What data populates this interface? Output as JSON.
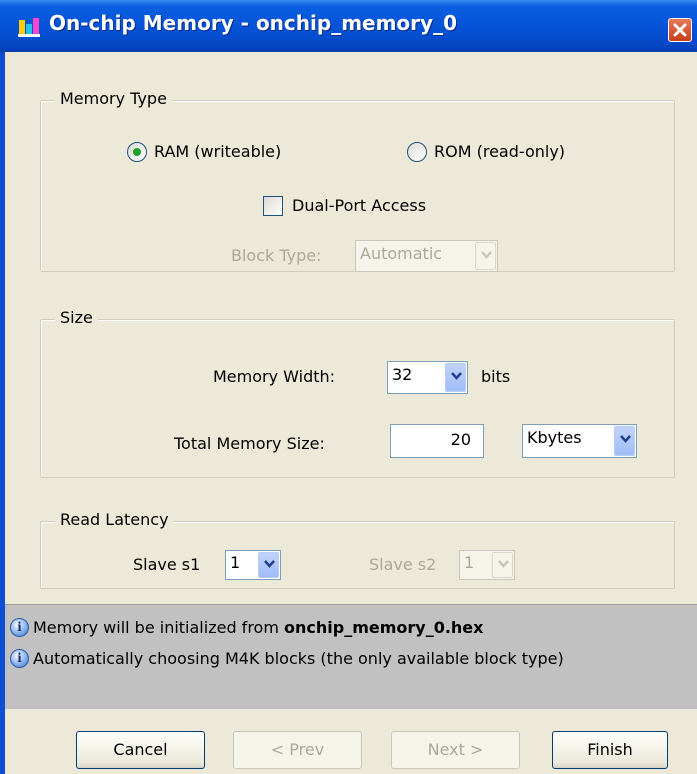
{
  "window": {
    "title": "On-chip Memory - onchip_memory_0",
    "app_icon": "altera-component-icon",
    "close_icon": "close-icon"
  },
  "memory_type": {
    "group_label": "Memory Type",
    "ram_label": "RAM (writeable)",
    "ram_selected": true,
    "rom_label": "ROM (read-only)",
    "rom_selected": false,
    "dual_port_label": "Dual-Port Access",
    "dual_port_checked": false,
    "block_type_label": "Block Type:",
    "block_type_value": "Automatic"
  },
  "size": {
    "group_label": "Size",
    "width_label": "Memory Width:",
    "width_value": "32",
    "width_unit": "bits",
    "total_label": "Total Memory Size:",
    "total_value": "20",
    "total_unit_value": "Kbytes"
  },
  "read_latency": {
    "group_label": "Read Latency",
    "s1_label": "Slave s1",
    "s1_value": "1",
    "s2_label": "Slave s2",
    "s2_value": "1"
  },
  "info": {
    "line1_prefix": "Memory will be initialized from ",
    "line1_bold": "onchip_memory_0.hex",
    "line2": "Automatically choosing M4K blocks (the only available block type)",
    "icon": "info-icon"
  },
  "buttons": {
    "cancel": "Cancel",
    "prev": "< Prev",
    "next": "Next >",
    "finish": "Finish"
  },
  "colors": {
    "titlebar": "#0553d8",
    "dialog_bg": "#ece9d8",
    "info_panel_bg": "#c1c1c1",
    "radio_dot": "#1f9f2a"
  }
}
